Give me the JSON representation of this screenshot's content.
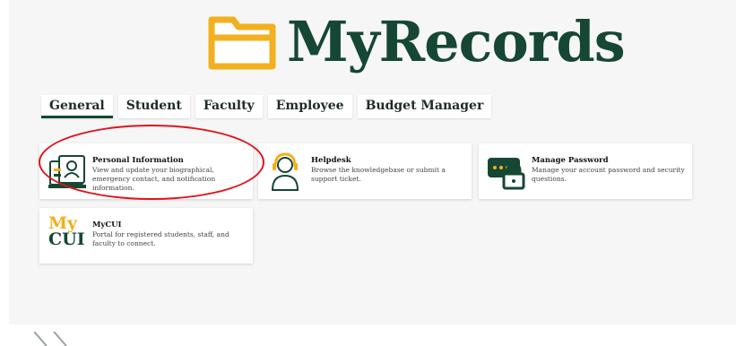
{
  "app": {
    "title": "MyRecords"
  },
  "tabs": [
    {
      "label": "General",
      "active": true
    },
    {
      "label": "Student"
    },
    {
      "label": "Faculty"
    },
    {
      "label": "Employee"
    },
    {
      "label": "Budget Manager"
    }
  ],
  "cards": [
    {
      "title": "Personal Information",
      "description": "View and update your biographical, emergency contact, and notification information.",
      "icon": "personal-information-icon"
    },
    {
      "title": "Helpdesk",
      "description": "Browse the knowledgebase or submit a support ticket.",
      "icon": "helpdesk-headset-icon"
    },
    {
      "title": "Manage Password",
      "description": "Manage your account password and security questions.",
      "icon": "password-lock-icon"
    },
    {
      "title": "MyCUI",
      "description": "Portal for registered students, staff, and faculty to connect.",
      "icon": "mycui-logo",
      "logo_lines": [
        "My",
        "CUI"
      ]
    }
  ],
  "colors": {
    "brand_green": "#154734",
    "brand_gold": "#f2b01e",
    "highlight_red": "#e0141b",
    "background": "#f6f6f6"
  }
}
